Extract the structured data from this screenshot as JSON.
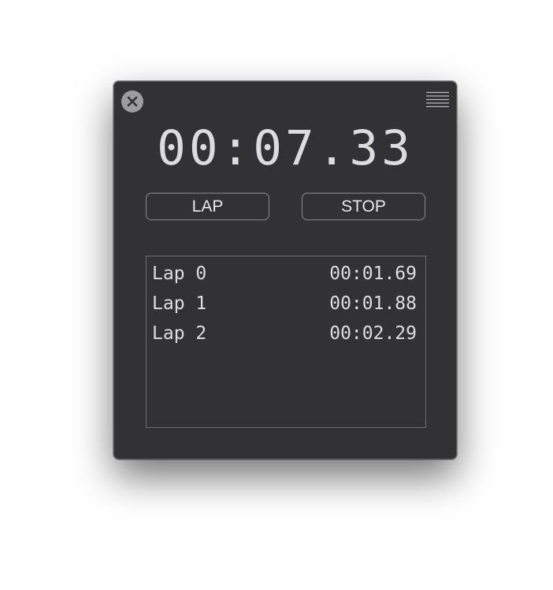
{
  "window": {
    "close_icon": "close-icon",
    "menu_icon": "menu-icon"
  },
  "stopwatch": {
    "time": "00:07.33"
  },
  "controls": {
    "lap_label": "LAP",
    "stop_label": "STOP"
  },
  "laps": [
    {
      "name": "Lap 0",
      "time": "00:01.69"
    },
    {
      "name": "Lap 1",
      "time": "00:01.88"
    },
    {
      "name": "Lap 2",
      "time": "00:02.29"
    }
  ]
}
